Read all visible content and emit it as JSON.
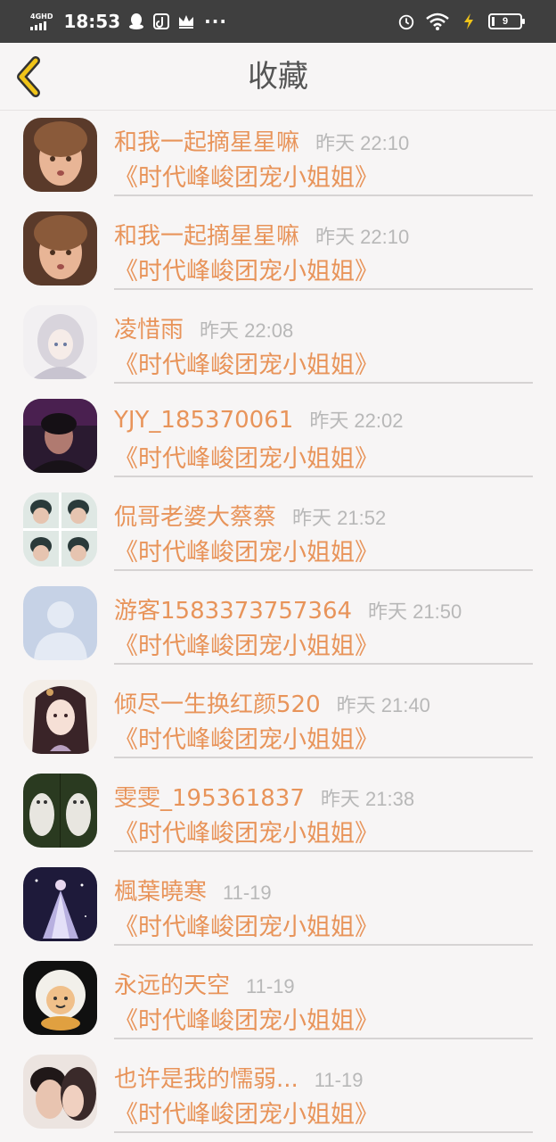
{
  "status_bar": {
    "network": "4GHD",
    "time": "18:53",
    "more": "···",
    "battery": "9"
  },
  "header": {
    "title": "收藏"
  },
  "favorites": [
    {
      "name": "和我一起摘星星嘛",
      "time": "昨天 22:10",
      "novel": "《时代峰峻团宠小姐姐》"
    },
    {
      "name": "和我一起摘星星嘛",
      "time": "昨天 22:10",
      "novel": "《时代峰峻团宠小姐姐》"
    },
    {
      "name": "凌惜雨",
      "time": "昨天 22:08",
      "novel": "《时代峰峻团宠小姐姐》"
    },
    {
      "name": "YJY_185370061",
      "time": "昨天 22:02",
      "novel": "《时代峰峻团宠小姐姐》"
    },
    {
      "name": "侃哥老婆大蔡蔡",
      "time": "昨天 21:52",
      "novel": "《时代峰峻团宠小姐姐》"
    },
    {
      "name": "游客1583373757364",
      "time": "昨天 21:50",
      "novel": "《时代峰峻团宠小姐姐》"
    },
    {
      "name": "倾尽一生换红颜520",
      "time": "昨天 21:40",
      "novel": "《时代峰峻团宠小姐姐》"
    },
    {
      "name": "雯雯_195361837",
      "time": "昨天 21:38",
      "novel": "《时代峰峻团宠小姐姐》"
    },
    {
      "name": "楓葉曉寒",
      "time": "11-19",
      "novel": "《时代峰峻团宠小姐姐》"
    },
    {
      "name": "永远的天空",
      "time": "11-19",
      "novel": "《时代峰峻团宠小姐姐》"
    },
    {
      "name": "也许是我的懦弱...",
      "time": "11-19",
      "novel": "《时代峰峻团宠小姐姐》"
    }
  ],
  "colors": {
    "accent": "#e8945a",
    "timestamp": "#b8b8b8",
    "back_arrow": "#f0c419",
    "status_bar_bg": "#3f3f3f"
  }
}
